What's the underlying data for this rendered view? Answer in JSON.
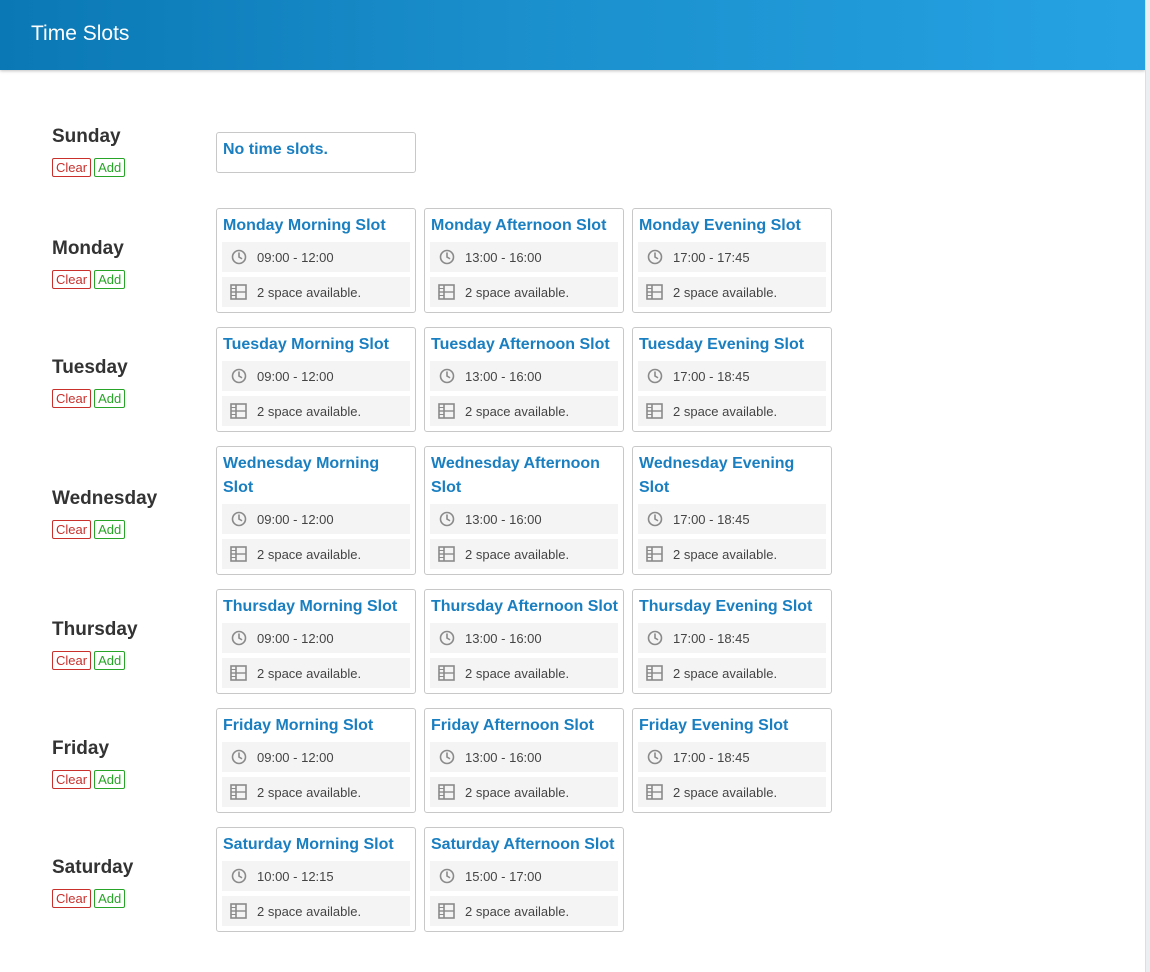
{
  "header": {
    "title": "Time Slots"
  },
  "buttons": {
    "clear": "Clear",
    "add": "Add"
  },
  "empty_text": "No time slots.",
  "days": [
    {
      "name": "Sunday",
      "slots": []
    },
    {
      "name": "Monday",
      "slots": [
        {
          "title": "Monday Morning Slot",
          "time": "09:00 - 12:00",
          "space": "2 space available."
        },
        {
          "title": "Monday Afternoon Slot",
          "time": "13:00 - 16:00",
          "space": "2 space available."
        },
        {
          "title": "Monday Evening Slot",
          "time": "17:00 - 17:45",
          "space": "2 space available."
        }
      ]
    },
    {
      "name": "Tuesday",
      "slots": [
        {
          "title": "Tuesday Morning Slot",
          "time": "09:00 - 12:00",
          "space": "2 space available."
        },
        {
          "title": "Tuesday Afternoon Slot",
          "time": "13:00 - 16:00",
          "space": "2 space available."
        },
        {
          "title": "Tuesday Evening Slot",
          "time": "17:00 - 18:45",
          "space": "2 space available."
        }
      ]
    },
    {
      "name": "Wednesday",
      "slots": [
        {
          "title": "Wednesday Morning Slot",
          "time": "09:00 - 12:00",
          "space": "2 space available."
        },
        {
          "title": "Wednesday Afternoon Slot",
          "time": "13:00 - 16:00",
          "space": "2 space available."
        },
        {
          "title": "Wednesday Evening Slot",
          "time": "17:00 - 18:45",
          "space": "2 space available."
        }
      ]
    },
    {
      "name": "Thursday",
      "slots": [
        {
          "title": "Thursday Morning Slot",
          "time": "09:00 - 12:00",
          "space": "2 space available."
        },
        {
          "title": "Thursday Afternoon Slot",
          "time": "13:00 - 16:00",
          "space": "2 space available."
        },
        {
          "title": "Thursday Evening Slot",
          "time": "17:00 - 18:45",
          "space": "2 space available."
        }
      ]
    },
    {
      "name": "Friday",
      "slots": [
        {
          "title": "Friday Morning Slot",
          "time": "09:00 - 12:00",
          "space": "2 space available."
        },
        {
          "title": "Friday Afternoon Slot",
          "time": "13:00 - 16:00",
          "space": "2 space available."
        },
        {
          "title": "Friday Evening Slot",
          "time": "17:00 - 18:45",
          "space": "2 space available."
        }
      ]
    },
    {
      "name": "Saturday",
      "slots": [
        {
          "title": "Saturday Morning Slot",
          "time": "10:00 - 12:15",
          "space": "2 space available."
        },
        {
          "title": "Saturday Afternoon Slot",
          "time": "15:00 - 17:00",
          "space": "2 space available."
        }
      ]
    }
  ]
}
